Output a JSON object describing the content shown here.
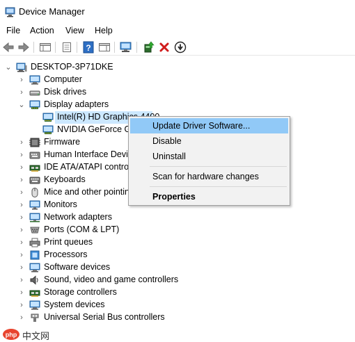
{
  "window": {
    "title": "Device Manager"
  },
  "menu": [
    "File",
    "Action",
    "View",
    "Help"
  ],
  "toolbar": {
    "buttons": [
      "back-icon",
      "forward-icon",
      "properties-pane-icon",
      "properties-icon",
      "help-icon",
      "action-pane-icon",
      "scan-hardware-icon",
      "update-driver-icon",
      "uninstall-icon",
      "disable-icon"
    ]
  },
  "tree": {
    "root": "DESKTOP-3P71DKE",
    "categories": [
      {
        "label": "Computer",
        "icon": "computer-icon"
      },
      {
        "label": "Disk drives",
        "icon": "disk-drive-icon"
      },
      {
        "label": "Display adapters",
        "icon": "display-adapter-icon",
        "expanded": true,
        "children": [
          "Intel(R) HD Graphics 4400",
          "NVIDIA GeForce GT"
        ]
      },
      {
        "label": "Firmware",
        "icon": "firmware-icon"
      },
      {
        "label": "Human Interface Devices",
        "icon": "hid-icon"
      },
      {
        "label": "IDE ATA/ATAPI controllers",
        "icon": "ide-controller-icon"
      },
      {
        "label": "Keyboards",
        "icon": "keyboard-icon"
      },
      {
        "label": "Mice and other pointing devices",
        "icon": "mouse-icon"
      },
      {
        "label": "Monitors",
        "icon": "monitor-icon"
      },
      {
        "label": "Network adapters",
        "icon": "network-adapter-icon"
      },
      {
        "label": "Ports (COM & LPT)",
        "icon": "port-icon"
      },
      {
        "label": "Print queues",
        "icon": "printer-icon"
      },
      {
        "label": "Processors",
        "icon": "processor-icon"
      },
      {
        "label": "Software devices",
        "icon": "software-device-icon"
      },
      {
        "label": "Sound, video and game controllers",
        "icon": "sound-icon"
      },
      {
        "label": "Storage controllers",
        "icon": "storage-controller-icon"
      },
      {
        "label": "System devices",
        "icon": "system-device-icon"
      },
      {
        "label": "Universal Serial Bus controllers",
        "icon": "usb-icon"
      }
    ]
  },
  "context_menu": {
    "items": [
      "Update Driver Software...",
      "Disable",
      "Uninstall",
      "Scan for hardware changes",
      "Properties"
    ],
    "highlighted": "Update Driver Software..."
  },
  "watermark": {
    "text": "中文网",
    "logo": "php-logo"
  }
}
